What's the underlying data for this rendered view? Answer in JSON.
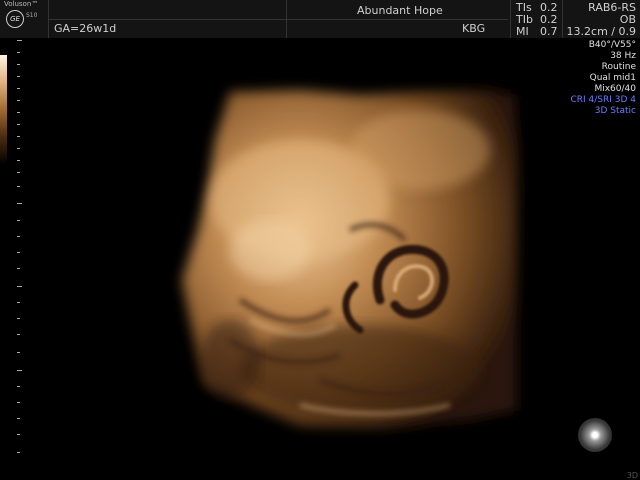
{
  "header": {
    "brand": "Voluson™",
    "logo": "GE",
    "model": "S10",
    "ga": "GA=26w1d",
    "facility": "Abundant Hope",
    "operator": "KBG"
  },
  "indices": {
    "tis_label": "TIs",
    "tis_value": "0.2",
    "tib_label": "TIb",
    "tib_value": "0.2",
    "mi_label": "MI",
    "mi_value": "0.7"
  },
  "probe": {
    "name": "RAB6-RS",
    "app": "OB"
  },
  "params": {
    "depth": "13.2cm / 0.9",
    "angle": "B40°/V55°",
    "rate": "38 Hz",
    "mode": "Routine",
    "quality": "Qual mid1",
    "mix": "Mix60/40",
    "cri": "CRI 4/SRI 3D 4",
    "static": "3D Static"
  },
  "corner_label": "3D",
  "colors": {
    "accent_blue": "#6a7cff",
    "sepia": "#c8925a"
  },
  "icons": [
    "ge-logo-icon",
    "trackball-indicator-icon"
  ]
}
